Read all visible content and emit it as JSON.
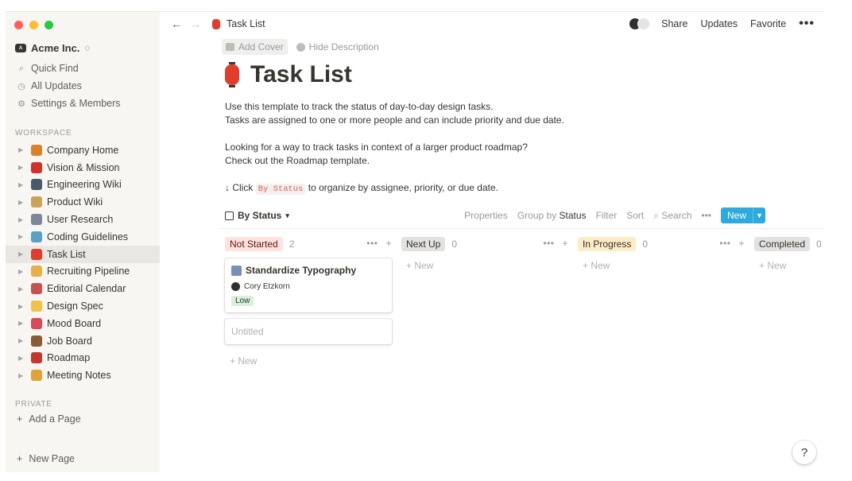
{
  "workspace": {
    "name": "Acme Inc.",
    "chevron": "◇"
  },
  "sidebar": {
    "nav": [
      {
        "label": "Quick Find",
        "icon": "search-icon",
        "glyph": "⌕"
      },
      {
        "label": "All Updates",
        "icon": "clock-icon",
        "glyph": "◷"
      },
      {
        "label": "Settings & Members",
        "icon": "gear-icon",
        "glyph": "⚙"
      }
    ],
    "workspace_label": "WORKSPACE",
    "pages": [
      {
        "label": "Company Home",
        "icon": "house-icon",
        "color": "#d9822b"
      },
      {
        "label": "Vision & Mission",
        "icon": "flag-icon",
        "color": "#d0312d"
      },
      {
        "label": "Engineering Wiki",
        "icon": "book-icon",
        "color": "#4a5a6a"
      },
      {
        "label": "Product Wiki",
        "icon": "whiteboard-icon",
        "color": "#c8a45a"
      },
      {
        "label": "User Research",
        "icon": "microscope-icon",
        "color": "#7d8799"
      },
      {
        "label": "Coding Guidelines",
        "icon": "bowl-icon",
        "color": "#5aa0c8"
      },
      {
        "label": "Task List",
        "icon": "lantern-icon",
        "color": "#e03e2d"
      },
      {
        "label": "Recruiting Pipeline",
        "icon": "hand-icon",
        "color": "#e8b04a"
      },
      {
        "label": "Editorial Calendar",
        "icon": "calendar-icon",
        "color": "#c75050"
      },
      {
        "label": "Design Spec",
        "icon": "sparkle-icon",
        "color": "#f0c24b"
      },
      {
        "label": "Mood Board",
        "icon": "ticket-icon",
        "color": "#d94b5c"
      },
      {
        "label": "Job Board",
        "icon": "briefcase-icon",
        "color": "#8a5a3a"
      },
      {
        "label": "Roadmap",
        "icon": "car-icon",
        "color": "#c0392b"
      },
      {
        "label": "Meeting Notes",
        "icon": "pencil-icon",
        "color": "#e0a23a"
      }
    ],
    "active_page": "Task List",
    "private_label": "PRIVATE",
    "add_page": "Add a Page",
    "new_page": "New Page"
  },
  "topbar": {
    "breadcrumb": "Task List",
    "share": "Share",
    "updates": "Updates",
    "favorite": "Favorite",
    "more": "•••"
  },
  "page": {
    "add_cover": "Add Cover",
    "hide_description": "Hide Description",
    "title": "Task List",
    "desc_line1": "Use this template to track the status of day-to-day design tasks.",
    "desc_line2": "Tasks are assigned to one or more people and can include priority and due date.",
    "desc_line3": "Looking for a way to track tasks in context of a larger product roadmap?",
    "desc_line4": "Check out the Roadmap template.",
    "click_prefix": "↓ Click",
    "click_code": "By Status",
    "click_suffix": "to organize by assignee, priority, or due date."
  },
  "view": {
    "name": "By Status",
    "properties": "Properties",
    "group_by_prefix": "Group by",
    "group_by_value": "Status",
    "filter": "Filter",
    "sort": "Sort",
    "search": "Search",
    "more": "•••",
    "new": "New"
  },
  "board": {
    "columns": [
      {
        "label": "Not Started",
        "count": "2",
        "bg": "#ffe2dd",
        "fg": "#5d1715"
      },
      {
        "label": "Next Up",
        "count": "0",
        "bg": "#e3e2e0",
        "fg": "#32302c"
      },
      {
        "label": "In Progress",
        "count": "0",
        "bg": "#fdecc8",
        "fg": "#402c1b"
      },
      {
        "label": "Completed",
        "count": "0",
        "bg": "#e3e2e0",
        "fg": "#32302c"
      }
    ],
    "card": {
      "title": "Standardize Typography",
      "assignee": "Cory Etzkorn",
      "priority": "Low"
    },
    "untitled": "Untitled",
    "new_label": "+ New",
    "col_actions": "•••   +"
  },
  "help": "?"
}
